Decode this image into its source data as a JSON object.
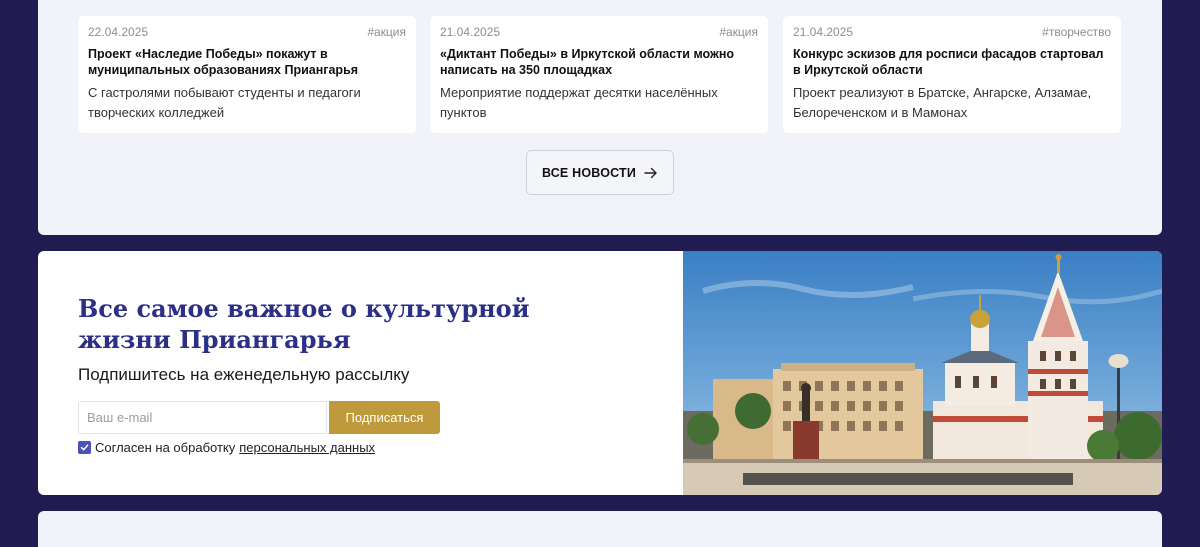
{
  "news": {
    "cards": [
      {
        "date": "22.04.2025",
        "tag": "#акция",
        "title": "Проект «Наследие Победы» покажут в муниципальных образованиях Приангарья",
        "text": "С гастролями побывают студенты и педагоги творческих колледжей"
      },
      {
        "date": "21.04.2025",
        "tag": "#акция",
        "title": "«Диктант Победы» в Иркутской области можно написать на 350 площадках",
        "text": "Мероприятие поддержат десятки населённых пунктов"
      },
      {
        "date": "21.04.2025",
        "tag": "#творчество",
        "title": "Конкурс эскизов для росписи фасадов стартовал в Иркутской области",
        "text": "Проект реализуют в Братске, Ангарске, Алзамае, Белореченском и в Мамонах"
      }
    ],
    "all_news_label": "ВСЕ НОВОСТИ",
    "arrow_icon": "arrow-right-icon"
  },
  "subscribe": {
    "title": "Все самое важное о культурной жизни Приангарья",
    "subtitle": "Подпишитесь на еженедельную рассылку",
    "email_placeholder": "Ваш e-mail",
    "button_label": "Подписаться",
    "consent_text": "Согласен на обработку",
    "consent_link": "персональных данных",
    "consent_checked": true
  },
  "colors": {
    "page_background": "#201c52",
    "panel_background": "#f2f3f8",
    "title_color": "#2b2f86",
    "button_color": "#bf9a3c",
    "checkbox_color": "#4b52b8"
  }
}
